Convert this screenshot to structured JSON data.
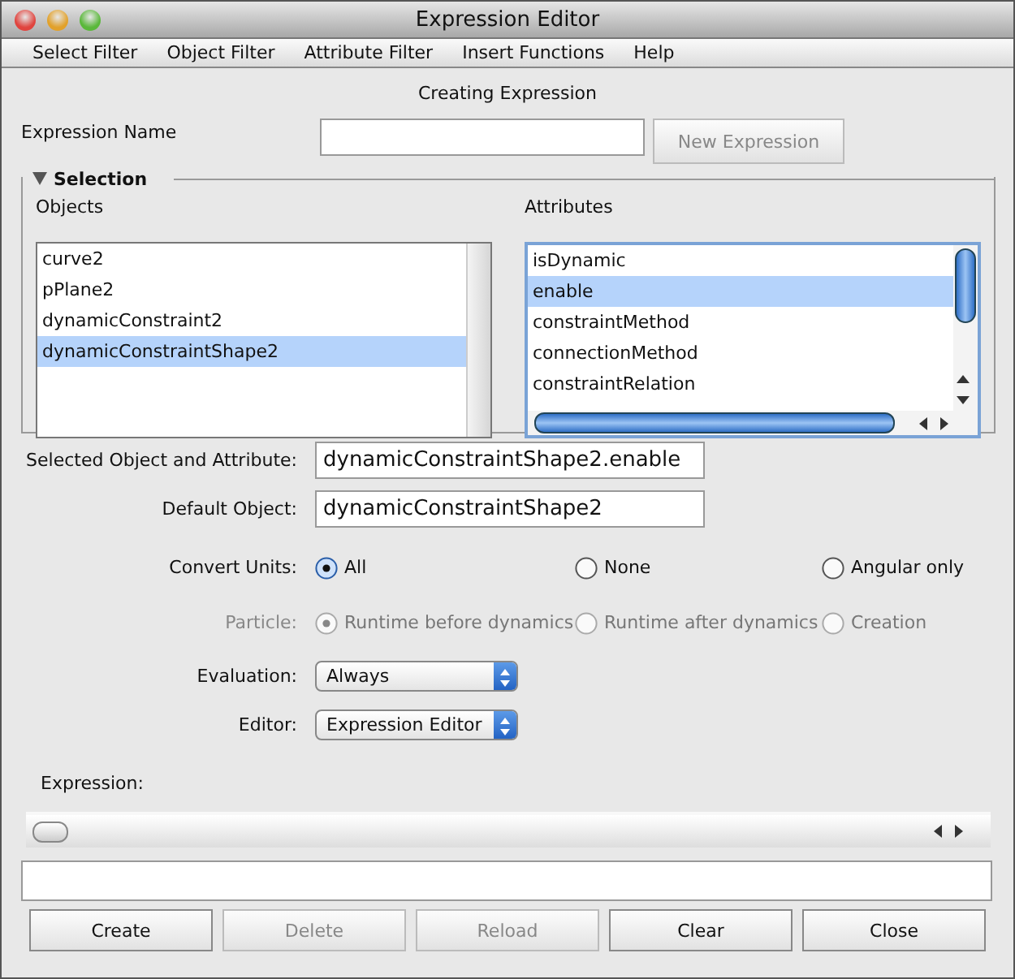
{
  "window": {
    "title": "Expression Editor"
  },
  "menu": [
    "Select Filter",
    "Object Filter",
    "Attribute Filter",
    "Insert Functions",
    "Help"
  ],
  "heading": "Creating Expression",
  "expression_name": {
    "label": "Expression Name",
    "button": {
      "label": "New Expression",
      "disabled": true
    }
  },
  "selection": {
    "title": "Selection",
    "expanded": true,
    "objects": {
      "label": "Objects",
      "items": [
        {
          "text": "curve2",
          "selected": false
        },
        {
          "text": "pPlane2",
          "selected": false
        },
        {
          "text": "dynamicConstraint2",
          "selected": false
        },
        {
          "text": "dynamicConstraintShape2",
          "selected": true
        }
      ]
    },
    "attributes": {
      "label": "Attributes",
      "items": [
        {
          "text": "isDynamic",
          "selected": false
        },
        {
          "text": "enable",
          "selected": true
        },
        {
          "text": "constraintMethod",
          "selected": false
        },
        {
          "text": "connectionMethod",
          "selected": false
        },
        {
          "text": "constraintRelation",
          "selected": false
        }
      ]
    }
  },
  "selected_object_attribute": {
    "label": "Selected Object and Attribute:",
    "value": "dynamicConstraintShape2.enable"
  },
  "default_object": {
    "label": "Default Object:",
    "value": "dynamicConstraintShape2"
  },
  "convert_units": {
    "label": "Convert Units:",
    "disabled": false,
    "options": [
      {
        "label": "All",
        "selected": true
      },
      {
        "label": "None",
        "selected": false
      },
      {
        "label": "Angular only",
        "selected": false
      }
    ]
  },
  "particle": {
    "label": "Particle:",
    "disabled": true,
    "options": [
      {
        "label": "Runtime before dynamics",
        "selected": true
      },
      {
        "label": "Runtime after dynamics",
        "selected": false
      },
      {
        "label": "Creation",
        "selected": false
      }
    ]
  },
  "evaluation": {
    "label": "Evaluation:",
    "value": "Always"
  },
  "editor": {
    "label": "Editor:",
    "value": "Expression Editor"
  },
  "expression": {
    "label": "Expression:"
  },
  "buttons": [
    {
      "label": "Create",
      "disabled": false
    },
    {
      "label": "Delete",
      "disabled": true
    },
    {
      "label": "Reload",
      "disabled": true
    },
    {
      "label": "Clear",
      "disabled": false
    },
    {
      "label": "Close",
      "disabled": false
    }
  ]
}
